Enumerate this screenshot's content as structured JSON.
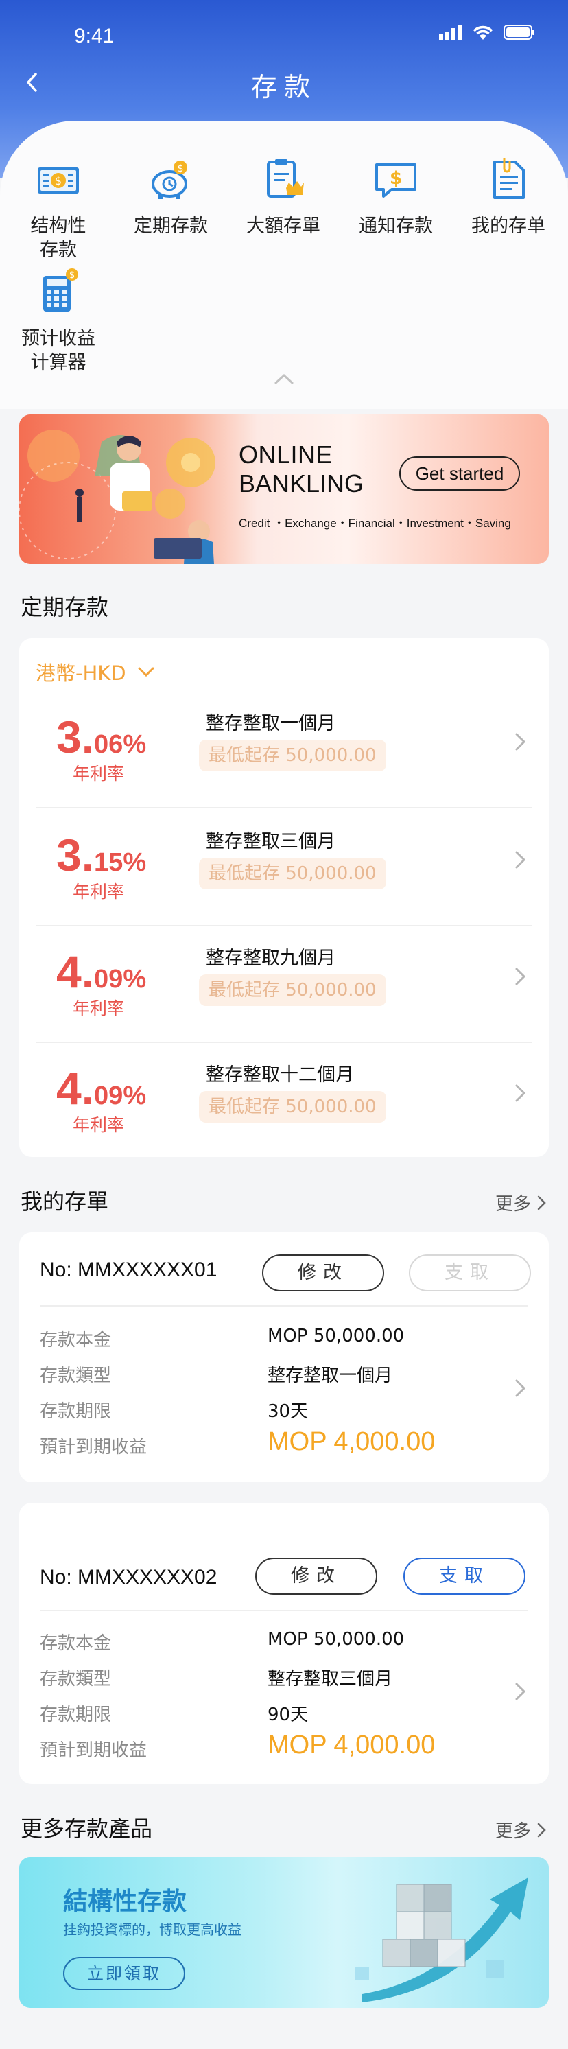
{
  "status_bar": {
    "time": "9:41"
  },
  "nav": {
    "title": "存款"
  },
  "quick_menu": [
    {
      "label": "结构性\n存款",
      "icon": "structured-deposit-icon"
    },
    {
      "label": "定期存款",
      "icon": "piggy-clock-icon"
    },
    {
      "label": "大額存單",
      "icon": "crown-document-icon"
    },
    {
      "label": "通知存款",
      "icon": "chat-dollar-icon"
    },
    {
      "label": "我的存单",
      "icon": "my-deposit-document-icon"
    },
    {
      "label": "预计收益\n计算器",
      "icon": "calculator-icon"
    }
  ],
  "banner": {
    "title_line1": "ONLINE",
    "title_line2": "BANKLING",
    "button": "Get started",
    "subtitle": "Credit ・Exchange・Financial・Investment・Saving"
  },
  "fixed_deposit": {
    "section_title": "定期存款",
    "currency": "港幣-HKD",
    "rate_label": "年利率",
    "items": [
      {
        "rate_int": "3.",
        "rate_dec": "06%",
        "name": "整存整取一個月",
        "min": "最低起存 50,000.00"
      },
      {
        "rate_int": "3.",
        "rate_dec": "15%",
        "name": "整存整取三個月",
        "min": "最低起存 50,000.00"
      },
      {
        "rate_int": "4.",
        "rate_dec": "09%",
        "name": "整存整取九個月",
        "min": "最低起存 50,000.00"
      },
      {
        "rate_int": "4.",
        "rate_dec": "09%",
        "name": "整存整取十二個月",
        "min": "最低起存 50,000.00"
      }
    ]
  },
  "my_orders": {
    "section_title": "我的存單",
    "more": "更多",
    "modify_label": "修改",
    "withdraw_label": "支取",
    "keys": {
      "principal": "存款本金",
      "type": "存款類型",
      "term": "存款期限",
      "yield": "預計到期收益"
    },
    "orders": [
      {
        "no": "No: MMXXXXXX01",
        "principal": "MOP 50,000.00",
        "type": "整存整取一個月",
        "term": "30天",
        "yield": "MOP 4,000.00",
        "withdraw_enabled": false
      },
      {
        "no": "No: MMXXXXXX02",
        "principal": "MOP 50,000.00",
        "type": "整存整取三個月",
        "term": "90天",
        "yield": "MOP 4,000.00",
        "withdraw_enabled": true
      }
    ]
  },
  "more_products": {
    "section_title": "更多存款產品",
    "more": "更多",
    "promo_title": "結構性存款",
    "promo_subtitle": "挂鈎投資標的，博取更高收益",
    "promo_button": "立即領取"
  },
  "colors": {
    "primary": "#2a59d2",
    "rate_red": "#e8534c",
    "accent_orange": "#f5a623",
    "link_blue": "#2a6bd8"
  }
}
